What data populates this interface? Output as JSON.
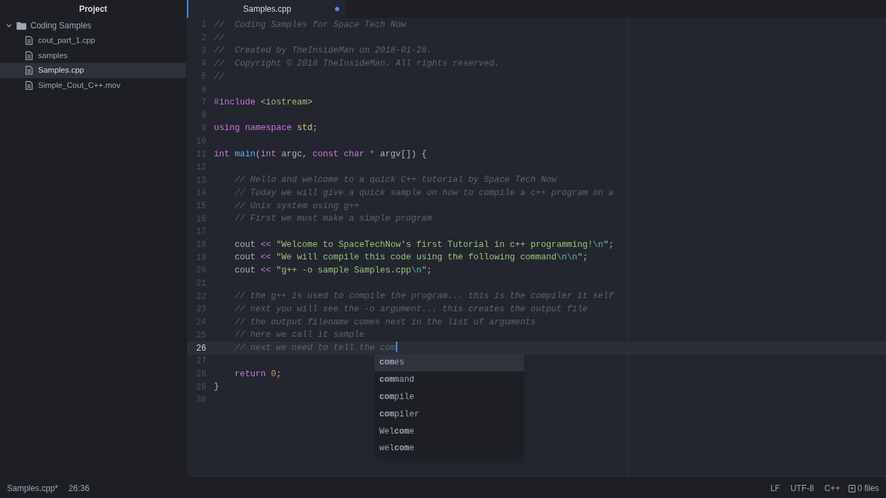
{
  "sidebar": {
    "title": "Project",
    "root": {
      "label": "Coding Samples",
      "expanded": true,
      "children": [
        {
          "label": "cout_part_1.cpp",
          "selected": false
        },
        {
          "label": "samples",
          "selected": false
        },
        {
          "label": "Samples.cpp",
          "selected": true
        },
        {
          "label": "Simple_Cout_C++.mov",
          "selected": false
        }
      ]
    }
  },
  "tabs": [
    {
      "label": "Samples.cpp",
      "selected": true,
      "modified": true
    }
  ],
  "editor": {
    "lines": [
      {
        "number": "1",
        "current": false,
        "tokens": [
          {
            "kind": "comment",
            "text": "//  Coding Samples for Space Tech Now"
          }
        ]
      },
      {
        "number": "2",
        "current": false,
        "tokens": [
          {
            "kind": "comment",
            "text": "//"
          }
        ]
      },
      {
        "number": "3",
        "current": false,
        "tokens": [
          {
            "kind": "comment",
            "text": "//  Created by TheInsideMan on 2018-01-28."
          }
        ]
      },
      {
        "number": "4",
        "current": false,
        "tokens": [
          {
            "kind": "comment",
            "text": "//  Copyright © 2018 TheInsideMan. All rights reserved."
          }
        ]
      },
      {
        "number": "5",
        "current": false,
        "tokens": [
          {
            "kind": "comment",
            "text": "//"
          }
        ]
      },
      {
        "number": "6",
        "current": false
      },
      {
        "number": "7",
        "current": false,
        "tokens": [
          {
            "kind": "keyword",
            "text": "#include "
          },
          {
            "kind": "string",
            "text": "<iostream>"
          }
        ]
      },
      {
        "number": "8",
        "current": false
      },
      {
        "number": "9",
        "current": false,
        "tokens": [
          {
            "kind": "keyword",
            "text": "using namespace "
          },
          {
            "kind": "type",
            "text": "std"
          },
          {
            "kind": "plain",
            "text": ";"
          }
        ]
      },
      {
        "number": "10",
        "current": false
      },
      {
        "number": "11",
        "current": false,
        "tokens": [
          {
            "kind": "keyword",
            "text": "int "
          },
          {
            "kind": "function",
            "text": "main"
          },
          {
            "kind": "plain",
            "text": "("
          },
          {
            "kind": "keyword",
            "text": "int"
          },
          {
            "kind": "plain",
            "text": " argc, "
          },
          {
            "kind": "keyword",
            "text": "const char *"
          },
          {
            "kind": "plain",
            "text": " argv[]) {"
          }
        ]
      },
      {
        "number": "12",
        "current": false
      },
      {
        "number": "13",
        "current": false,
        "tokens": [
          {
            "kind": "comment",
            "text": "    // Hello and welcome to a quick C++ tutorial by Space Tech Now"
          }
        ]
      },
      {
        "number": "14",
        "current": false,
        "tokens": [
          {
            "kind": "comment",
            "text": "    // Today we will give a quick sample on how to compile a c++ program on a"
          }
        ]
      },
      {
        "number": "15",
        "current": false,
        "tokens": [
          {
            "kind": "comment",
            "text": "    // Unix system using g++"
          }
        ]
      },
      {
        "number": "16",
        "current": false,
        "tokens": [
          {
            "kind": "comment",
            "text": "    // First we must make a simple program"
          }
        ]
      },
      {
        "number": "17",
        "current": false
      },
      {
        "number": "18",
        "current": false,
        "tokens": [
          {
            "kind": "plain",
            "text": "    cout "
          },
          {
            "kind": "keyword",
            "text": "<< "
          },
          {
            "kind": "string",
            "text": "\"Welcome to SpaceTechNow's first Tutorial in c++ programming!"
          },
          {
            "kind": "escape",
            "text": "\\n"
          },
          {
            "kind": "string",
            "text": "\""
          },
          {
            "kind": "plain",
            "text": ";"
          }
        ]
      },
      {
        "number": "19",
        "current": false,
        "tokens": [
          {
            "kind": "plain",
            "text": "    cout "
          },
          {
            "kind": "keyword",
            "text": "<< "
          },
          {
            "kind": "string",
            "text": "\"We will compile this code using the following command"
          },
          {
            "kind": "escape",
            "text": "\\n\\n"
          },
          {
            "kind": "string",
            "text": "\""
          },
          {
            "kind": "plain",
            "text": ";"
          }
        ]
      },
      {
        "number": "20",
        "current": false,
        "tokens": [
          {
            "kind": "plain",
            "text": "    cout "
          },
          {
            "kind": "keyword",
            "text": "<< "
          },
          {
            "kind": "string",
            "text": "\"g++ -o sample Samples.cpp"
          },
          {
            "kind": "escape",
            "text": "\\n"
          },
          {
            "kind": "string",
            "text": "\""
          },
          {
            "kind": "plain",
            "text": ";"
          }
        ]
      },
      {
        "number": "21",
        "current": false
      },
      {
        "number": "22",
        "current": false,
        "tokens": [
          {
            "kind": "comment",
            "text": "    // the g++ is used to compile the program... this is the compiler it self"
          }
        ]
      },
      {
        "number": "23",
        "current": false,
        "tokens": [
          {
            "kind": "comment",
            "text": "    // next you will see the -o argument... this creates the output file"
          }
        ]
      },
      {
        "number": "24",
        "current": false,
        "tokens": [
          {
            "kind": "comment",
            "text": "    // the output filename comes next in the list of arguments"
          }
        ]
      },
      {
        "number": "25",
        "current": false,
        "tokens": [
          {
            "kind": "comment",
            "text": "    // here we call it sample"
          }
        ]
      },
      {
        "number": "26",
        "current": true,
        "tokens": [
          {
            "kind": "comment",
            "text": "    // next we need to tell the com"
          }
        ]
      },
      {
        "number": "27",
        "current": false
      },
      {
        "number": "28",
        "current": false,
        "tokens": [
          {
            "kind": "keyword",
            "text": "    return "
          },
          {
            "kind": "number",
            "text": "0"
          },
          {
            "kind": "plain",
            "text": ";"
          }
        ]
      },
      {
        "number": "29",
        "current": false,
        "tokens": [
          {
            "kind": "plain",
            "text": "}"
          }
        ]
      },
      {
        "number": "30",
        "current": false
      }
    ],
    "autocomplete": [
      {
        "label": "**com**es",
        "selected": true
      },
      {
        "label": "**com**mand",
        "selected": false
      },
      {
        "label": "**com**pile",
        "selected": false
      },
      {
        "label": "**com**piler",
        "selected": false
      },
      {
        "label": "Wel**com**e",
        "selected": false
      },
      {
        "label": "wel**com**e",
        "selected": false
      }
    ]
  },
  "status_bar": {
    "left": [
      "Samples.cpp*",
      "26:36"
    ],
    "right": [
      "LF",
      "UTF-8",
      "C++"
    ],
    "files": "0 files"
  }
}
